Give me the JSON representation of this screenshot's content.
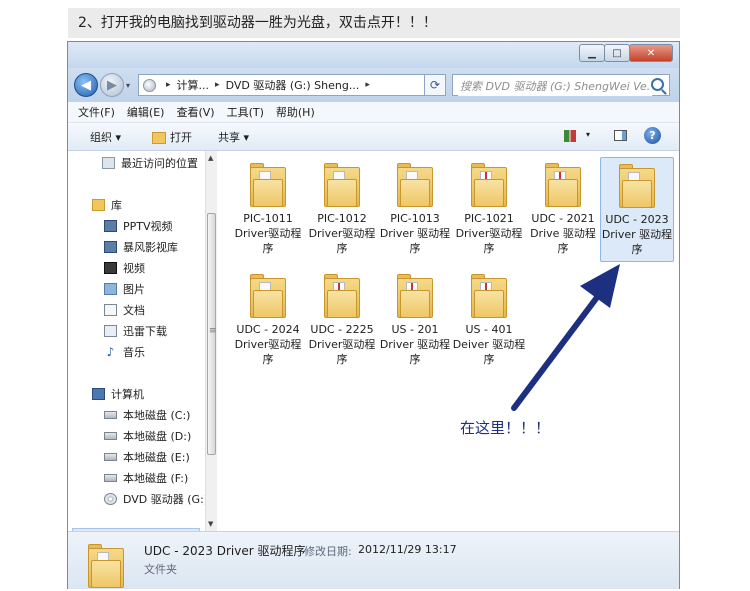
{
  "caption": "2、打开我的电脑找到驱动器一胜为光盘，双击点开！！！",
  "window": {
    "controls": {
      "minimize": "▁",
      "maximize": "□",
      "close": "✕"
    },
    "address": {
      "segments": [
        "计算...",
        "DVD 驱动器 (G:) Sheng..."
      ],
      "separator": "▸",
      "dropdown": "▾",
      "refresh": "⟳"
    },
    "search": {
      "placeholder": "搜索 DVD 驱动器 (G:) ShengWei Ve..."
    },
    "menu": [
      "文件(F)",
      "编辑(E)",
      "查看(V)",
      "工具(T)",
      "帮助(H)"
    ],
    "toolbar": {
      "organize": "组织 ▾",
      "open": "打开",
      "share": "共享 ▾",
      "view_dropdown": "▾",
      "help": "?"
    },
    "nav": {
      "recent": "最近访问的位置",
      "libraries": "库",
      "library_items": [
        "PPTV视频",
        "暴风影视库",
        "视频",
        "图片",
        "文档",
        "迅雷下载",
        "音乐"
      ],
      "computer": "计算机",
      "drives": [
        "本地磁盘 (C:)",
        "本地磁盘 (D:)",
        "本地磁盘 (E:)",
        "本地磁盘 (F:)"
      ],
      "dvd": "DVD 驱动器 (G:)"
    },
    "files": [
      {
        "name": "PIC-1011 Driver驱动程序"
      },
      {
        "name": "PIC-1012 Driver驱动程序"
      },
      {
        "name": "PIC-1013 Driver 驱动程序"
      },
      {
        "name": "PIC-1021 Driver驱动程序"
      },
      {
        "name": "UDC - 2021 Drive 驱动程序"
      },
      {
        "name": "UDC - 2023 Driver 驱动程序",
        "selected": true
      },
      {
        "name": "UDC - 2024 Driver驱动程序"
      },
      {
        "name": "UDC - 2225 Driver驱动程序"
      },
      {
        "name": "US - 201 Driver 驱动程序"
      },
      {
        "name": "US - 401 Deiver 驱动程序"
      }
    ],
    "status": {
      "name": "UDC - 2023 Driver 驱动程序",
      "modified_label": "修改日期:",
      "modified_value": "2012/11/29 13:17",
      "type": "文件夹"
    }
  },
  "annotation": "在这里！！！",
  "colors": {
    "arrow": "#1d2f80",
    "selection": "#dce9f8",
    "titlebar": "#c4d7ee"
  }
}
